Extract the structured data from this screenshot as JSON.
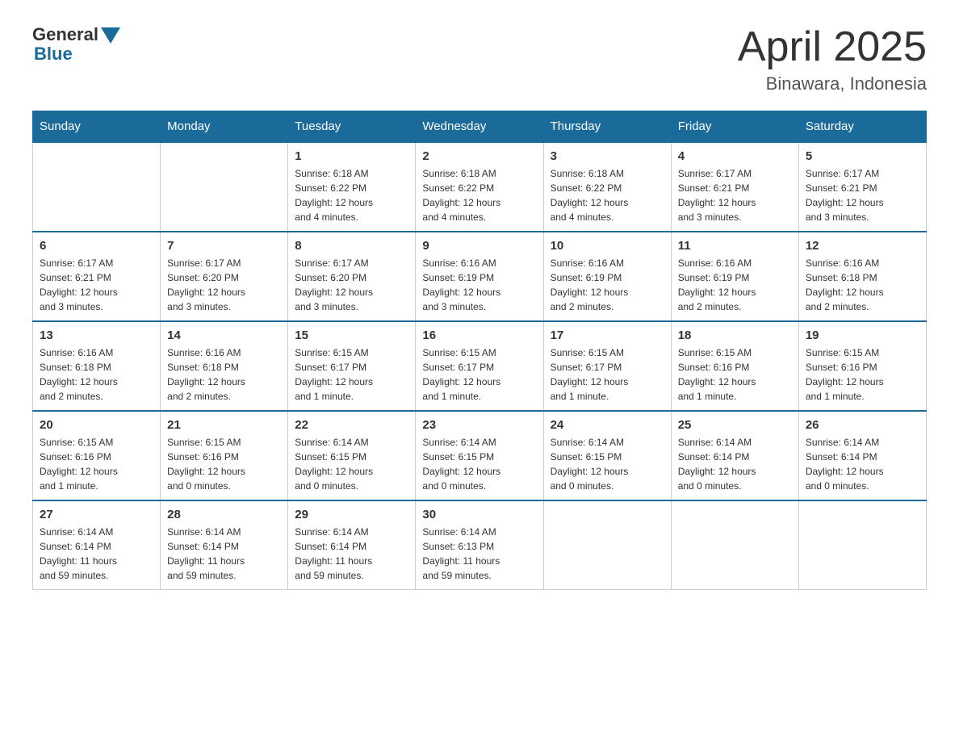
{
  "header": {
    "logo_general": "General",
    "logo_blue": "Blue",
    "month_title": "April 2025",
    "location": "Binawara, Indonesia"
  },
  "weekdays": [
    "Sunday",
    "Monday",
    "Tuesday",
    "Wednesday",
    "Thursday",
    "Friday",
    "Saturday"
  ],
  "weeks": [
    [
      {
        "day": "",
        "info": ""
      },
      {
        "day": "",
        "info": ""
      },
      {
        "day": "1",
        "info": "Sunrise: 6:18 AM\nSunset: 6:22 PM\nDaylight: 12 hours\nand 4 minutes."
      },
      {
        "day": "2",
        "info": "Sunrise: 6:18 AM\nSunset: 6:22 PM\nDaylight: 12 hours\nand 4 minutes."
      },
      {
        "day": "3",
        "info": "Sunrise: 6:18 AM\nSunset: 6:22 PM\nDaylight: 12 hours\nand 4 minutes."
      },
      {
        "day": "4",
        "info": "Sunrise: 6:17 AM\nSunset: 6:21 PM\nDaylight: 12 hours\nand 3 minutes."
      },
      {
        "day": "5",
        "info": "Sunrise: 6:17 AM\nSunset: 6:21 PM\nDaylight: 12 hours\nand 3 minutes."
      }
    ],
    [
      {
        "day": "6",
        "info": "Sunrise: 6:17 AM\nSunset: 6:21 PM\nDaylight: 12 hours\nand 3 minutes."
      },
      {
        "day": "7",
        "info": "Sunrise: 6:17 AM\nSunset: 6:20 PM\nDaylight: 12 hours\nand 3 minutes."
      },
      {
        "day": "8",
        "info": "Sunrise: 6:17 AM\nSunset: 6:20 PM\nDaylight: 12 hours\nand 3 minutes."
      },
      {
        "day": "9",
        "info": "Sunrise: 6:16 AM\nSunset: 6:19 PM\nDaylight: 12 hours\nand 3 minutes."
      },
      {
        "day": "10",
        "info": "Sunrise: 6:16 AM\nSunset: 6:19 PM\nDaylight: 12 hours\nand 2 minutes."
      },
      {
        "day": "11",
        "info": "Sunrise: 6:16 AM\nSunset: 6:19 PM\nDaylight: 12 hours\nand 2 minutes."
      },
      {
        "day": "12",
        "info": "Sunrise: 6:16 AM\nSunset: 6:18 PM\nDaylight: 12 hours\nand 2 minutes."
      }
    ],
    [
      {
        "day": "13",
        "info": "Sunrise: 6:16 AM\nSunset: 6:18 PM\nDaylight: 12 hours\nand 2 minutes."
      },
      {
        "day": "14",
        "info": "Sunrise: 6:16 AM\nSunset: 6:18 PM\nDaylight: 12 hours\nand 2 minutes."
      },
      {
        "day": "15",
        "info": "Sunrise: 6:15 AM\nSunset: 6:17 PM\nDaylight: 12 hours\nand 1 minute."
      },
      {
        "day": "16",
        "info": "Sunrise: 6:15 AM\nSunset: 6:17 PM\nDaylight: 12 hours\nand 1 minute."
      },
      {
        "day": "17",
        "info": "Sunrise: 6:15 AM\nSunset: 6:17 PM\nDaylight: 12 hours\nand 1 minute."
      },
      {
        "day": "18",
        "info": "Sunrise: 6:15 AM\nSunset: 6:16 PM\nDaylight: 12 hours\nand 1 minute."
      },
      {
        "day": "19",
        "info": "Sunrise: 6:15 AM\nSunset: 6:16 PM\nDaylight: 12 hours\nand 1 minute."
      }
    ],
    [
      {
        "day": "20",
        "info": "Sunrise: 6:15 AM\nSunset: 6:16 PM\nDaylight: 12 hours\nand 1 minute."
      },
      {
        "day": "21",
        "info": "Sunrise: 6:15 AM\nSunset: 6:16 PM\nDaylight: 12 hours\nand 0 minutes."
      },
      {
        "day": "22",
        "info": "Sunrise: 6:14 AM\nSunset: 6:15 PM\nDaylight: 12 hours\nand 0 minutes."
      },
      {
        "day": "23",
        "info": "Sunrise: 6:14 AM\nSunset: 6:15 PM\nDaylight: 12 hours\nand 0 minutes."
      },
      {
        "day": "24",
        "info": "Sunrise: 6:14 AM\nSunset: 6:15 PM\nDaylight: 12 hours\nand 0 minutes."
      },
      {
        "day": "25",
        "info": "Sunrise: 6:14 AM\nSunset: 6:14 PM\nDaylight: 12 hours\nand 0 minutes."
      },
      {
        "day": "26",
        "info": "Sunrise: 6:14 AM\nSunset: 6:14 PM\nDaylight: 12 hours\nand 0 minutes."
      }
    ],
    [
      {
        "day": "27",
        "info": "Sunrise: 6:14 AM\nSunset: 6:14 PM\nDaylight: 11 hours\nand 59 minutes."
      },
      {
        "day": "28",
        "info": "Sunrise: 6:14 AM\nSunset: 6:14 PM\nDaylight: 11 hours\nand 59 minutes."
      },
      {
        "day": "29",
        "info": "Sunrise: 6:14 AM\nSunset: 6:14 PM\nDaylight: 11 hours\nand 59 minutes."
      },
      {
        "day": "30",
        "info": "Sunrise: 6:14 AM\nSunset: 6:13 PM\nDaylight: 11 hours\nand 59 minutes."
      },
      {
        "day": "",
        "info": ""
      },
      {
        "day": "",
        "info": ""
      },
      {
        "day": "",
        "info": ""
      }
    ]
  ]
}
